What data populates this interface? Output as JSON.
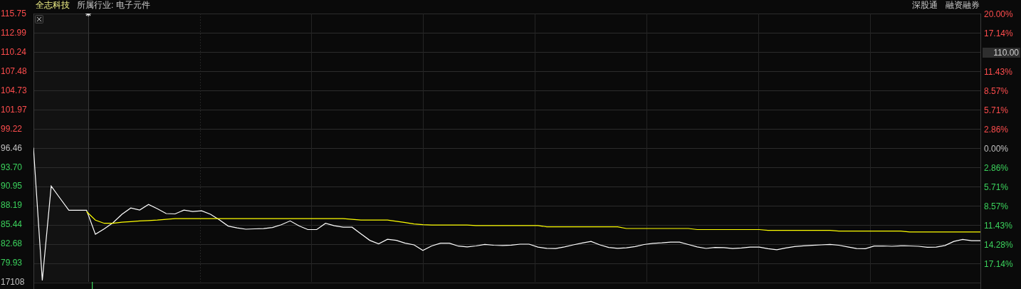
{
  "header": {
    "stock_name": "全志科技",
    "industry": "所属行业: 电子元件",
    "badges": [
      "深股通",
      "融资融券"
    ]
  },
  "volume_label": "17108",
  "percent_axis": [
    {
      "kind": "tick",
      "label": "20.00%",
      "color": "#ff4d4d"
    },
    {
      "kind": "tick",
      "label": "17.14%",
      "color": "#ff4d4d"
    },
    {
      "kind": "price_tag",
      "label": "110.00"
    },
    {
      "kind": "tick",
      "label": "11.43%",
      "color": "#ff4d4d"
    },
    {
      "kind": "tick",
      "label": "8.57%",
      "color": "#ff4d4d"
    },
    {
      "kind": "tick",
      "label": "5.71%",
      "color": "#ff4d4d"
    },
    {
      "kind": "tick",
      "label": "2.86%",
      "color": "#ff4d4d"
    },
    {
      "kind": "tick",
      "label": "0.00%",
      "color": "#c0c0c0"
    },
    {
      "kind": "tick",
      "label": "2.86%",
      "color": "#3bd25c"
    },
    {
      "kind": "tick",
      "label": "5.71%",
      "color": "#3bd25c"
    },
    {
      "kind": "tick",
      "label": "8.57%",
      "color": "#3bd25c"
    },
    {
      "kind": "tick",
      "label": "11.43%",
      "color": "#3bd25c"
    },
    {
      "kind": "tick",
      "label": "14.28%",
      "color": "#3bd25c"
    },
    {
      "kind": "tick",
      "label": "17.14%",
      "color": "#3bd25c"
    }
  ],
  "chart_data": {
    "type": "line",
    "grid": true,
    "ylim": [
      77.18,
      115.75
    ],
    "yticks": [
      {
        "value": 115.75,
        "label": "115.75"
      },
      {
        "value": 112.99,
        "label": "112.99"
      },
      {
        "value": 110.24,
        "label": "110.24"
      },
      {
        "value": 107.48,
        "label": "107.48"
      },
      {
        "value": 104.73,
        "label": "104.73"
      },
      {
        "value": 101.97,
        "label": "101.97"
      },
      {
        "value": 99.22,
        "label": "99.22"
      },
      {
        "value": 96.46,
        "label": "96.46"
      },
      {
        "value": 93.7,
        "label": "93.70"
      },
      {
        "value": 90.95,
        "label": "90.95"
      },
      {
        "value": 88.19,
        "label": "88.19"
      },
      {
        "value": 85.44,
        "label": "85.44"
      },
      {
        "value": 82.68,
        "label": "82.68"
      },
      {
        "value": 79.93,
        "label": "79.93"
      }
    ],
    "categories": [
      null,
      null,
      null,
      null,
      null,
      null,
      null,
      null,
      null,
      null,
      null,
      null,
      null,
      null,
      null,
      null,
      null,
      null,
      null,
      null,
      null,
      null,
      null,
      null,
      null,
      null,
      null,
      null,
      null,
      null,
      null,
      null,
      null,
      null,
      null,
      null,
      null,
      null,
      null,
      null,
      null,
      null,
      null,
      null,
      null,
      null,
      null,
      null,
      null,
      null,
      null,
      null,
      null,
      null,
      null,
      null,
      null,
      null,
      null,
      null,
      null,
      null,
      null,
      null,
      null,
      null,
      null,
      null,
      null,
      null,
      null,
      null,
      null,
      null,
      null,
      null,
      null,
      null,
      null,
      null,
      null,
      null,
      null,
      null,
      null,
      null,
      null,
      null,
      null,
      null,
      null,
      null,
      null,
      null,
      null,
      null,
      null,
      null,
      null,
      null,
      null,
      null,
      null,
      null,
      null,
      null,
      null,
      null
    ],
    "series": [
      {
        "color": "#ffffff",
        "values": [
          96.46,
          77.38,
          90.95,
          89.2,
          87.48,
          87.48,
          87.48,
          84.02,
          84.8,
          85.7,
          86.9,
          87.8,
          87.5,
          88.3,
          87.7,
          87.0,
          86.95,
          87.5,
          87.3,
          87.4,
          86.9,
          86.1,
          85.2,
          84.95,
          84.75,
          84.8,
          84.83,
          85.0,
          85.4,
          85.95,
          85.24,
          84.7,
          84.7,
          85.6,
          85.25,
          85.04,
          85.04,
          84.1,
          83.15,
          82.65,
          83.3,
          83.15,
          82.75,
          82.5,
          81.7,
          82.35,
          82.75,
          82.75,
          82.33,
          82.2,
          82.35,
          82.57,
          82.45,
          82.42,
          82.47,
          82.6,
          82.6,
          82.18,
          82.0,
          81.97,
          82.2,
          82.5,
          82.78,
          83.0,
          82.5,
          82.13,
          82.0,
          82.07,
          82.25,
          82.55,
          82.73,
          82.79,
          82.9,
          82.9,
          82.55,
          82.2,
          81.99,
          82.12,
          82.1,
          81.98,
          82.05,
          82.18,
          82.18,
          81.95,
          81.8,
          82.05,
          82.25,
          82.37,
          82.43,
          82.5,
          82.57,
          82.45,
          82.2,
          81.97,
          81.95,
          82.33,
          82.35,
          82.3,
          82.36,
          82.35,
          82.3,
          82.16,
          82.18,
          82.42,
          83.0,
          83.28,
          83.1,
          83.1
        ]
      },
      {
        "color": "#ffff00",
        "values": [
          null,
          null,
          null,
          null,
          null,
          null,
          87.28,
          86.06,
          85.6,
          85.6,
          85.75,
          85.85,
          85.95,
          86.0,
          86.06,
          86.16,
          86.26,
          86.26,
          86.26,
          86.26,
          86.26,
          86.26,
          86.26,
          86.26,
          86.26,
          86.26,
          86.26,
          86.26,
          86.26,
          86.26,
          86.26,
          86.26,
          86.26,
          86.26,
          86.26,
          86.26,
          86.16,
          86.06,
          86.06,
          86.06,
          86.06,
          85.9,
          85.7,
          85.5,
          85.4,
          85.35,
          85.35,
          85.35,
          85.35,
          85.35,
          85.28,
          85.28,
          85.28,
          85.28,
          85.28,
          85.28,
          85.28,
          85.28,
          85.1,
          85.1,
          85.1,
          85.1,
          85.1,
          85.1,
          85.1,
          85.1,
          85.1,
          84.85,
          84.85,
          84.85,
          84.85,
          84.85,
          84.85,
          84.85,
          84.85,
          84.7,
          84.7,
          84.7,
          84.7,
          84.7,
          84.7,
          84.7,
          84.7,
          84.58,
          84.58,
          84.58,
          84.58,
          84.58,
          84.58,
          84.58,
          84.58,
          84.47,
          84.47,
          84.47,
          84.47,
          84.47,
          84.47,
          84.47,
          84.47,
          84.35,
          84.35,
          84.35,
          84.35,
          84.35,
          84.35,
          84.35,
          84.35,
          84.35
        ]
      }
    ]
  }
}
